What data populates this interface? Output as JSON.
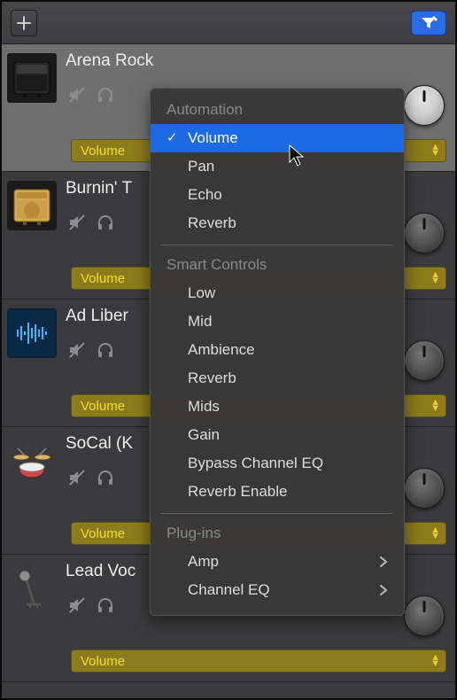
{
  "topbar": {
    "add_label": "+",
    "filter_label": "filter"
  },
  "tracks": [
    {
      "name": "Arena Rock",
      "selector": "Volume"
    },
    {
      "name": "Burnin' T",
      "selector": "Volume"
    },
    {
      "name": "Ad Liber",
      "selector": "Volume"
    },
    {
      "name": "SoCal (K",
      "selector": "Volume"
    },
    {
      "name": "Lead Voc",
      "selector": "Volume"
    }
  ],
  "menu": {
    "section1": "Automation",
    "items1": {
      "a": "Volume",
      "b": "Pan",
      "c": "Echo",
      "d": "Reverb"
    },
    "section2": "Smart Controls",
    "items2": {
      "a": "Low",
      "b": "Mid",
      "c": "Ambience",
      "d": "Reverb",
      "e": "Mids",
      "f": "Gain",
      "g": "Bypass Channel EQ",
      "h": "Reverb Enable"
    },
    "section3": "Plug-ins",
    "items3": {
      "a": "Amp",
      "b": "Channel EQ"
    }
  }
}
